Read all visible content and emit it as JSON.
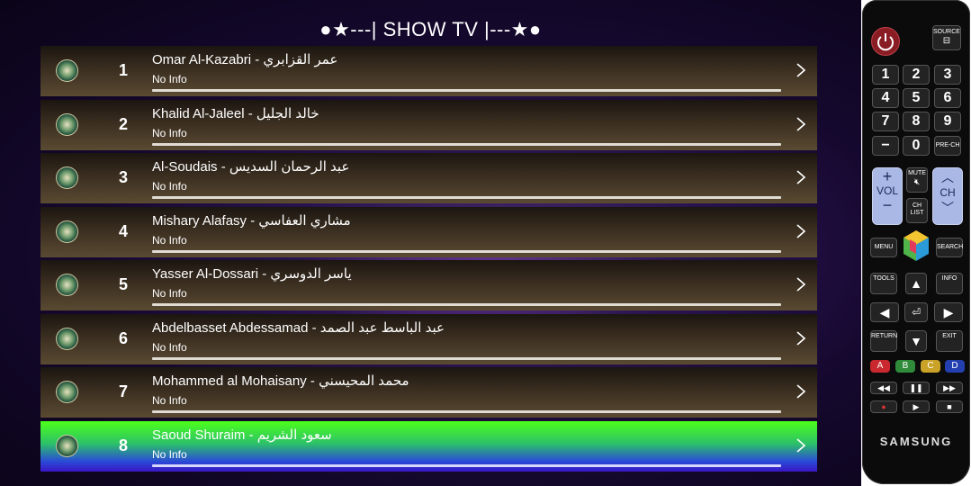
{
  "header": {
    "title": "●★---| SHOW TV |---★●"
  },
  "channels": [
    {
      "number": "1",
      "name": "Omar Al-Kazabri - عمر القزابري",
      "info": "No Info"
    },
    {
      "number": "2",
      "name": "Khalid Al-Jaleel - خالد الجليل",
      "info": "No Info"
    },
    {
      "number": "3",
      "name": "Al-Soudais - عبد الرحمان السديس",
      "info": "No Info"
    },
    {
      "number": "4",
      "name": "Mishary Alafasy - مشاري العفاسي",
      "info": "No Info"
    },
    {
      "number": "5",
      "name": "Yasser Al-Dossari - ياسر الدوسري",
      "info": "No Info"
    },
    {
      "number": "6",
      "name": "Abdelbasset Abdessamad - عبد الباسط عبد الصمد",
      "info": "No Info"
    },
    {
      "number": "7",
      "name": "Mohammed al Mohaisany - محمد المحيسني",
      "info": "No Info"
    },
    {
      "number": "8",
      "name": "Saoud Shuraim - سعود الشريم",
      "info": "No Info"
    }
  ],
  "selected_index": 7,
  "remote": {
    "source": "SOURCE",
    "digits": [
      "1",
      "2",
      "3",
      "4",
      "5",
      "6",
      "7",
      "8",
      "9"
    ],
    "minus": "−",
    "zero": "0",
    "prech": "PRE-CH",
    "vol": "VOL",
    "ch": "CH",
    "mute": "MUTE",
    "chlist": "CH LIST",
    "menu": "MENU",
    "search": "SEARCH",
    "tools": "TOOLS",
    "info": "INFO",
    "return": "RETURN",
    "exit": "EXIT",
    "color_a": "A",
    "color_b": "B",
    "color_c": "C",
    "color_d": "D",
    "brand": "SAMSUNG"
  }
}
